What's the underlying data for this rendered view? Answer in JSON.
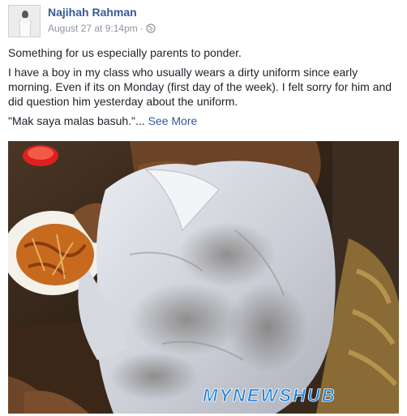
{
  "post": {
    "author": "Najihah Rahman",
    "timestamp": "August 27 at 9:14pm",
    "separator": "·",
    "privacy_icon": "globe-icon",
    "paragraphs": [
      "Something for us especially parents to ponder.",
      "I have a boy in my class who usually wears a dirty uniform since early morning. Even if its on Monday (first day of the week). I felt sorry for him and did question him yesterday about the uniform."
    ],
    "quote": "\"Mak saya malas basuh.\"",
    "ellipsis": "...",
    "see_more": "See More"
  },
  "photo": {
    "watermark": "MYNEWSHUB",
    "colors": {
      "background": "#3a2a1c",
      "shirt": "#dcdfe6",
      "skin": "#7a4e2c",
      "plate": "#f4f1ea",
      "food": "#c86a1e",
      "lid": "#e0201e",
      "watermark": "#1e7fd8"
    }
  },
  "colors": {
    "link": "#365899",
    "meta": "#90949c",
    "text": "#1d2129"
  }
}
